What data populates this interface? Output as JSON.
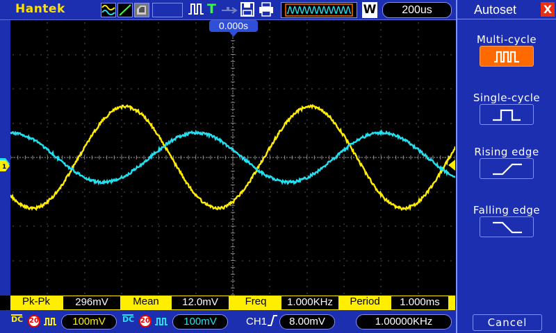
{
  "topbar": {
    "brand": "Hantek",
    "timebase": "200us",
    "mode_badge": "W"
  },
  "screen": {
    "trigger_position": "0.000s"
  },
  "measurements": [
    {
      "label": "Pk-Pk",
      "value": "296mV"
    },
    {
      "label": "Mean",
      "value": "12.0mV"
    },
    {
      "label": "Freq",
      "value": "1.000KHz"
    },
    {
      "label": "Period",
      "value": "1.000ms"
    }
  ],
  "bottombar": {
    "ch1": {
      "coupling": "DC",
      "bw_limit": "20",
      "volts_div": "100mV",
      "color": "#ffee00"
    },
    "ch2": {
      "coupling": "DC",
      "bw_limit": "20",
      "volts_div": "100mV",
      "color": "#22e0f0"
    },
    "trigger": {
      "source": "CH1",
      "level": "8.00mV"
    },
    "frequency_counter": "1.00000KHz"
  },
  "panel": {
    "title": "Autoset",
    "close": "X",
    "options": [
      {
        "label": "Multi-cycle",
        "icon": "multi-pulse-icon",
        "active": true
      },
      {
        "label": "Single-cycle",
        "icon": "single-pulse-icon",
        "active": false
      },
      {
        "label": "Rising edge",
        "icon": "rising-edge-icon",
        "active": false
      },
      {
        "label": "Falling edge",
        "icon": "falling-edge-icon",
        "active": false
      }
    ],
    "cancel": "Cancel"
  },
  "colors": {
    "ch1": "#ffee00",
    "ch2": "#22e0f0",
    "ui_blue": "#1c2fb0",
    "accent": "#ff6a00"
  }
}
